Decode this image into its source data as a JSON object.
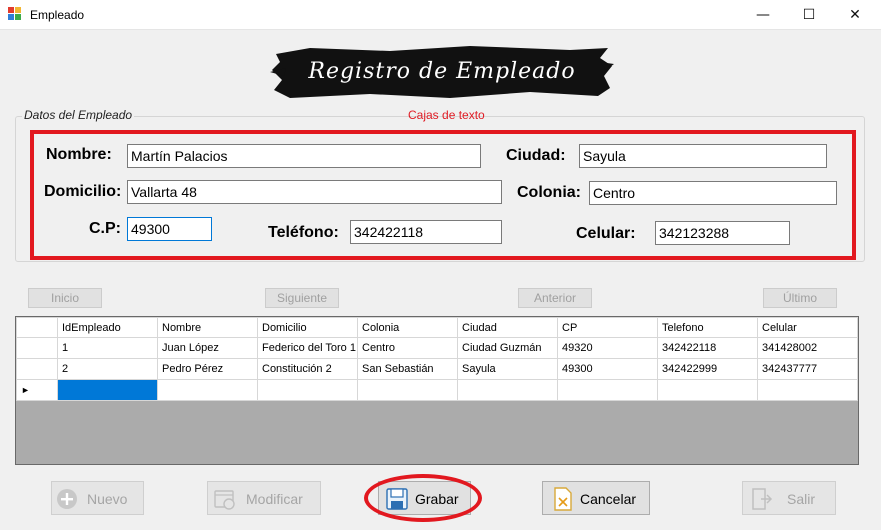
{
  "window": {
    "title": "Empleado",
    "minimize_glyph": "—",
    "maximize_glyph": "☐",
    "close_glyph": "✕"
  },
  "header": {
    "banner_text": "Registro de Empleado"
  },
  "group": {
    "legend": "Datos del Empleado"
  },
  "annotation": {
    "textboxes_label": "Cajas de texto",
    "color": "#e2181f"
  },
  "form": {
    "nombre": {
      "label": "Nombre:",
      "value": "Martín Palacios"
    },
    "ciudad": {
      "label": "Ciudad:",
      "value": "Sayula"
    },
    "domicilio": {
      "label": "Domicilio:",
      "value": "Vallarta 48"
    },
    "colonia": {
      "label": "Colonia:",
      "value": "Centro"
    },
    "cp": {
      "label": "C.P:",
      "value": "49300"
    },
    "telefono": {
      "label": "Teléfono:",
      "value": "342422118"
    },
    "celular": {
      "label": "Celular:",
      "value": "342123288"
    }
  },
  "nav": {
    "inicio": "Inicio",
    "siguiente": "Siguiente",
    "anterior": "Anterior",
    "ultimo": "Último"
  },
  "grid": {
    "columns": [
      "IdEmpleado",
      "Nombre",
      "Domicilio",
      "Colonia",
      "Ciudad",
      "CP",
      "Telefono",
      "Celular"
    ],
    "rows": [
      [
        "1",
        "Juan López",
        "Federico del Toro 1",
        "Centro",
        "Ciudad Guzmán",
        "49320",
        "342422118",
        "341428002"
      ],
      [
        "2",
        "Pedro Pérez",
        "Constitución 2",
        "San Sebastián",
        "Sayula",
        "49300",
        "342422999",
        "342437777"
      ]
    ],
    "new_row_marker": "►",
    "selection_color": "#0078d7"
  },
  "actions": {
    "nuevo": {
      "label": "Nuevo",
      "icon": "plus-circle-icon"
    },
    "modificar": {
      "label": "Modificar",
      "icon": "edit-icon"
    },
    "grabar": {
      "label": "Grabar",
      "icon": "floppy-disk-icon"
    },
    "cancelar": {
      "label": "Cancelar",
      "icon": "document-x-icon"
    },
    "salir": {
      "label": "Salir",
      "icon": "exit-door-icon"
    }
  }
}
